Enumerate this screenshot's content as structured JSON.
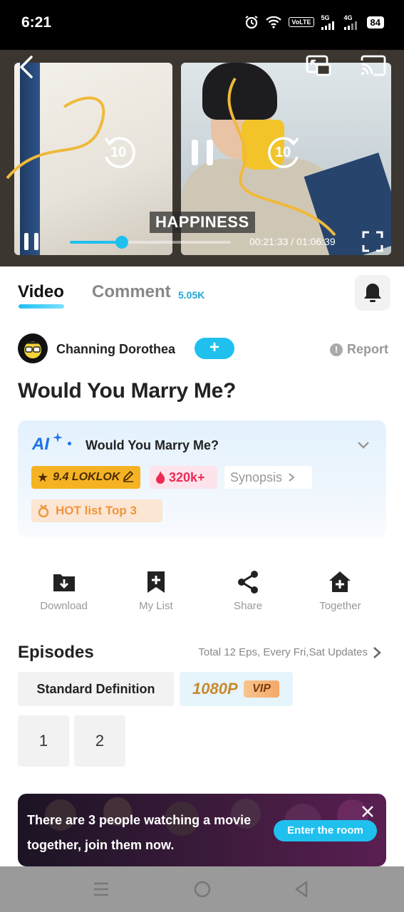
{
  "status_bar": {
    "time": "6:21",
    "volte": "VoLTE",
    "sim1": "1",
    "sim2": "2",
    "net1": "5G",
    "net2": "4G",
    "battery": "84"
  },
  "player": {
    "subtitle": "HAPPINESS",
    "current_time": "00:21:33",
    "separator": "/",
    "total_time": "01:06:39",
    "progress_fraction": 0.325,
    "rewind_seconds": "10",
    "forward_seconds": "10",
    "accent_color": "#20c0ee"
  },
  "tabs": {
    "video_label": "Video",
    "comment_label": "Comment",
    "comment_count": "5.05K"
  },
  "uploader": {
    "name": "Channing Dorothea",
    "follow_label": "+",
    "report_label": "Report"
  },
  "show": {
    "title": "Would You Marry Me?"
  },
  "ai_card": {
    "logo": "AI",
    "title": "Would You Marry Me?",
    "rating": "9.4 LOKLOK",
    "heat": "320k+",
    "synopsis_label": "Synopsis",
    "hot_list": "HOT list Top 3"
  },
  "actions": [
    {
      "label": "Download",
      "icon": "download-icon"
    },
    {
      "label": "My List",
      "icon": "bookmark-add-icon"
    },
    {
      "label": "Share",
      "icon": "share-icon"
    },
    {
      "label": "Together",
      "icon": "home-add-icon"
    }
  ],
  "episodes": {
    "title": "Episodes",
    "info": "Total 12 Eps, Every Fri,Sat Updates",
    "definitions": {
      "standard": "Standard Definition",
      "hd": "1080P",
      "vip": "VIP"
    },
    "list": [
      "1",
      "2"
    ]
  },
  "banner": {
    "text": "There are 3 people watching a movie together, join them now.",
    "button": "Enter the room"
  }
}
